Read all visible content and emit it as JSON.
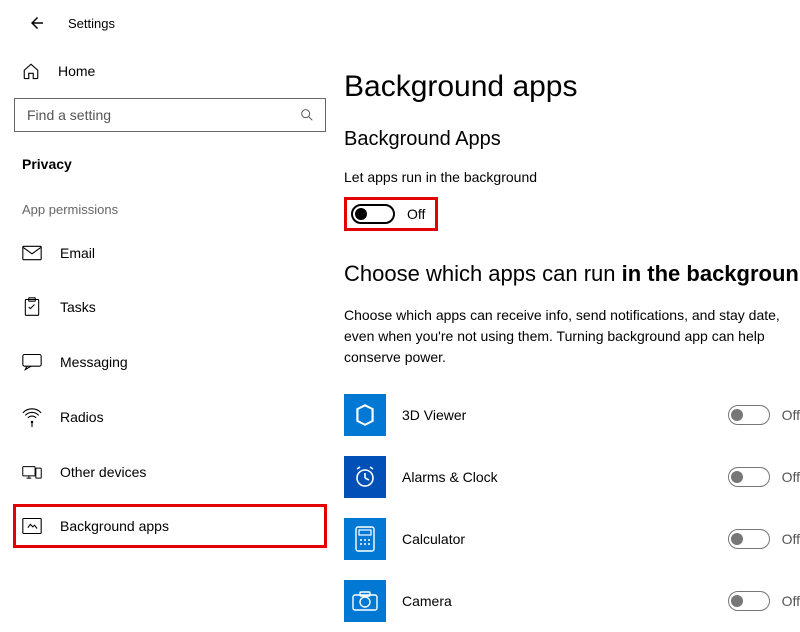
{
  "header": {
    "title": "Settings"
  },
  "sidebar": {
    "home": "Home",
    "search_placeholder": "Find a setting",
    "section": "Privacy",
    "group": "App permissions",
    "items": [
      {
        "label": "Email"
      },
      {
        "label": "Tasks"
      },
      {
        "label": "Messaging"
      },
      {
        "label": "Radios"
      },
      {
        "label": "Other devices"
      },
      {
        "label": "Background apps"
      }
    ]
  },
  "page": {
    "title": "Background apps",
    "section1_title": "Background Apps",
    "section1_desc": "Let apps run in the background",
    "toggle_state": "Off",
    "section2_title_a": "Choose which apps can run ",
    "section2_title_b": "in the backgroun",
    "section2_desc": "Choose which apps can receive info, send notifications, and stay date, even when you're not using them. Turning background app can help conserve power.",
    "apps": [
      {
        "name": "3D Viewer",
        "state": "Off"
      },
      {
        "name": "Alarms & Clock",
        "state": "Off"
      },
      {
        "name": "Calculator",
        "state": "Off"
      },
      {
        "name": "Camera",
        "state": "Off"
      }
    ]
  }
}
